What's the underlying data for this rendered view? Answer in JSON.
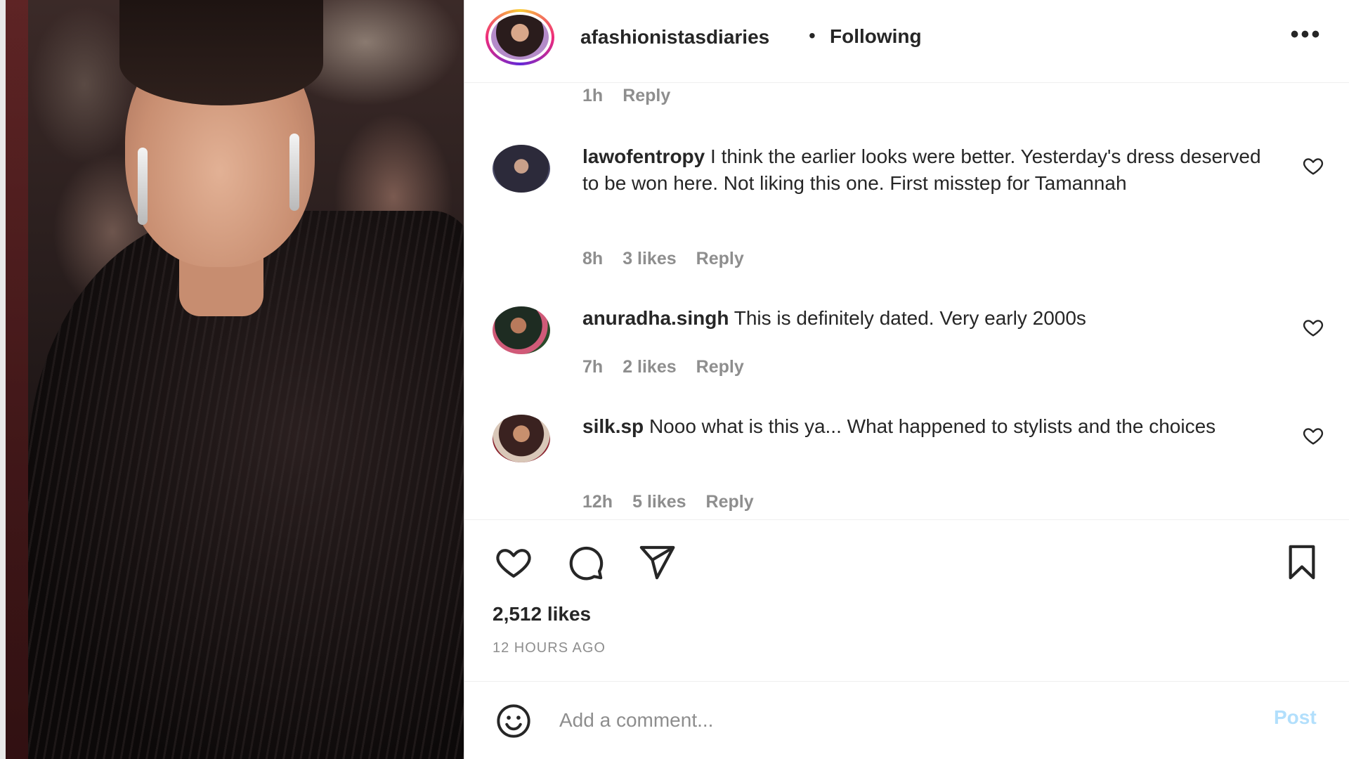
{
  "post": {
    "username": "afashionistasdiaries",
    "separator": "•",
    "follow_status": "Following",
    "more_label": "•••",
    "likes": "2,512 likes",
    "time_ago": "12 HOURS AGO"
  },
  "prev_comment_meta": {
    "time": "1h",
    "reply": "Reply"
  },
  "comments": [
    {
      "username": "lawofentropy",
      "text": "I think the earlier looks were better. Yesterday's dress deserved to be won here. Not liking this one. First misstep for Tamannah",
      "time": "8h",
      "likes": "3 likes",
      "reply": "Reply"
    },
    {
      "username": "anuradha.singh",
      "text": "This is definitely dated. Very early 2000s",
      "time": "7h",
      "likes": "2 likes",
      "reply": "Reply"
    },
    {
      "username": "silk.sp",
      "text": "Nooo what is this ya... What happened to stylists and the choices",
      "time": "12h",
      "likes": "5 likes",
      "reply": "Reply"
    }
  ],
  "add_comment": {
    "placeholder": "Add a comment...",
    "post_label": "Post"
  },
  "icons": {
    "like": "heart-icon",
    "comment": "comment-icon",
    "share": "paper-plane-icon",
    "save": "bookmark-icon",
    "emoji": "smiley-icon"
  },
  "colors": {
    "text": "#262626",
    "secondary": "#8e8e8e",
    "post_disabled": "#b2dffc"
  }
}
